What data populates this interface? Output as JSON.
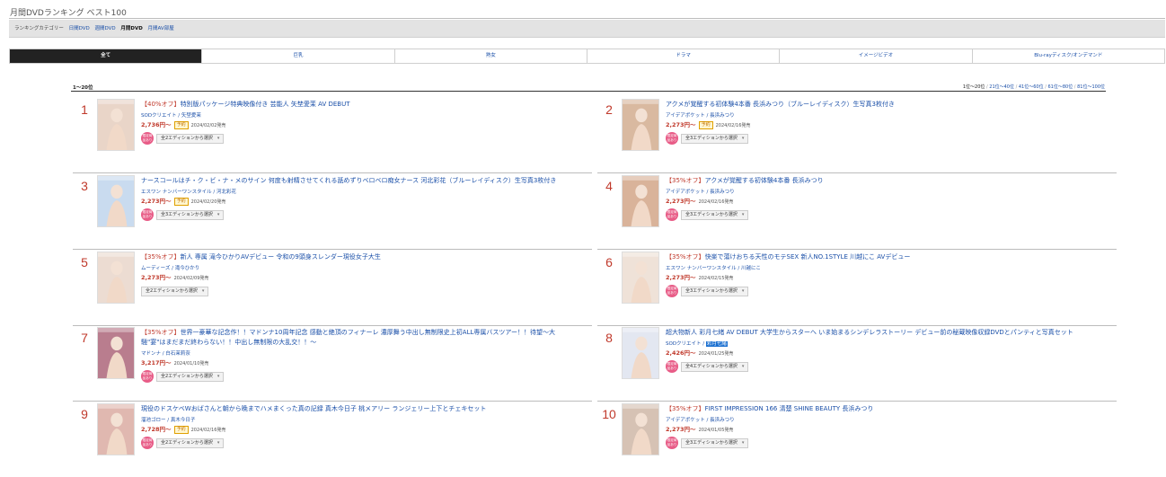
{
  "page": {
    "title": "月間DVDランキング ベスト100"
  },
  "category_bar": {
    "label": "ランキングカテゴリー",
    "links": [
      "日間DVD",
      "週間DVD",
      "月間DVD",
      "月間AV部屋"
    ],
    "active_index": 2
  },
  "genre_tabs": [
    {
      "label": "全て",
      "active": true
    },
    {
      "label": "巨乳",
      "active": false
    },
    {
      "label": "熟女",
      "active": false
    },
    {
      "label": "ドラマ",
      "active": false
    },
    {
      "label": "イメージビデオ",
      "active": false
    },
    {
      "label": "Blu-rayディスク/オンデマンド",
      "active": false
    }
  ],
  "range_label": "1〜20位",
  "pagination": {
    "current": "1位〜20位",
    "links": [
      "21位〜40位",
      "41位〜60位",
      "61位〜80位",
      "81位〜100位"
    ]
  },
  "colors": {
    "accent_blue": "#1a4fa8",
    "rank_red": "#c0392b",
    "limited_pink": "#e85c87",
    "tab_active_bg": "#222222"
  },
  "items": [
    {
      "rank": "1",
      "discount": "【40%オフ】",
      "title": "特別版パッケージ特典映像付き 芸能人 矢埜愛茉 AV DEBUT",
      "maker": "SODクリエイト / 矢埜愛茉",
      "price": "2,736円〜",
      "badge": "予約",
      "date": "2024/02/02発売",
      "edition": "全2エディションから選択",
      "limited": "限定商品あり",
      "thumb_tone": "#e9d5c8"
    },
    {
      "rank": "2",
      "discount": "",
      "title": "アクメが覚醒する初体験4本番 長浜みつり（ブルーレイディスク）生写真3枚付き",
      "maker": "アイデアポケット / 長浜みつり",
      "price": "2,273円〜",
      "badge": "予約",
      "date": "2024/02/16発売",
      "edition": "全3エディションから選択",
      "limited": "限定商品あり",
      "thumb_tone": "#d9b9a0"
    },
    {
      "rank": "3",
      "discount": "",
      "title": "ナースコールはチ・ク・ビ・ナ・メのサイン 何度も射精させてくれる舐めずりベロベロ痴女ナース 河北彩花（ブルーレイディスク）生写真3枚付き",
      "maker": "エスワン ナンバーワンスタイル / 河北彩花",
      "price": "2,273円〜",
      "badge": "予約",
      "date": "2024/02/20発売",
      "edition": "全3エディションから選択",
      "limited": "限定商品あり",
      "thumb_tone": "#c9dbef"
    },
    {
      "rank": "4",
      "discount": "【35%オフ】",
      "title": "アクメが覚醒する初体験4本番 長浜みつり",
      "maker": "アイデアポケット / 長浜みつり",
      "price": "2,273円〜",
      "badge": "",
      "date": "2024/02/16発売",
      "edition": "全3エディションから選択",
      "limited": "限定商品あり",
      "thumb_tone": "#d9b39a"
    },
    {
      "rank": "5",
      "discount": "【35%オフ】",
      "title": "新人 専属 滝今ひかりAVデビュー 令和の9頭身スレンダー現役女子大生",
      "maker": "ムーディーズ / 滝今ひかり",
      "price": "2,273円〜",
      "badge": "",
      "date": "2024/02/09発売",
      "edition": "全2エディションから選択",
      "limited": "",
      "thumb_tone": "#ecdcd2"
    },
    {
      "rank": "6",
      "discount": "【35%オフ】",
      "title": "快楽で蕩けおちる天性のモテSEX 新人NO.1STYLE 川越にこ AVデビュー",
      "maker": "エスワン ナンバーワンスタイル / 川越にこ",
      "price": "2,273円〜",
      "badge": "",
      "date": "2024/02/15発売",
      "edition": "全3エディションから選択",
      "limited": "限定商品あり",
      "thumb_tone": "#efe2d8"
    },
    {
      "rank": "7",
      "discount": "【35%オフ】",
      "title": "世界一豪華な記念作！！マドンナ10周年記念 感動と絶頂のフィナーレ 濃厚舞う中出し無制限史上初ALL専属バスツアー！！待望〜大騒\"宴\"はまだまだ終わらない！！中出し無制限の大乱交！！〜",
      "maker": "マドンナ / 白石茉莉奈",
      "price": "3,217円〜",
      "badge": "",
      "date": "2024/01/10発売",
      "edition": "全2エディションから選択",
      "limited": "限定商品あり",
      "thumb_tone": "#b97d8e"
    },
    {
      "rank": "8",
      "discount": "",
      "title": "超大物新人 彩月七緒 AV DEBUT 大学生からスターへ いま始まるシンデレラストーリー デビュー前の秘蔵映像収録DVDとパンティと写真セット",
      "maker": "SODクリエイト / ",
      "maker_highlight": "彩月七緒",
      "price": "2,426円〜",
      "badge": "",
      "date": "2024/01/25発売",
      "edition": "全4エディションから選択",
      "limited": "限定商品あり",
      "thumb_tone": "#e3e7f1"
    },
    {
      "rank": "9",
      "discount": "",
      "title": "現役のドスケベWおばさんと朝から晩までハメまくった真の記録 真木今日子 桃メアリー ランジェリー上下とチェキセット",
      "maker": "溜池ゴロー / 真木今日子",
      "price": "2,728円〜",
      "badge": "予約",
      "date": "2024/02/16発売",
      "edition": "全2エディションから選択",
      "limited": "限定商品あり",
      "thumb_tone": "#e0b8b0"
    },
    {
      "rank": "10",
      "discount": "【35%オフ】",
      "title": "FIRST IMPRESSION 166 清楚 SHINE BEAUTY 長浜みつり",
      "maker": "アイデアポケット / 長浜みつり",
      "price": "2,273円〜",
      "badge": "",
      "date": "2024/01/05発売",
      "edition": "全3エディションから選択",
      "limited": "限定商品あり",
      "thumb_tone": "#d6c2b4"
    }
  ]
}
